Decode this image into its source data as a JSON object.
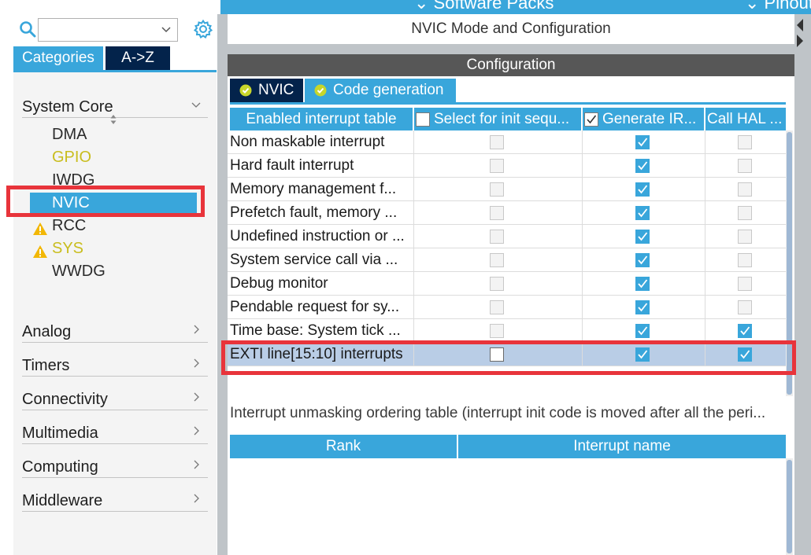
{
  "topbar": {
    "software_packs": "⌄ Software Packs",
    "pinout": "⌄ Pinout"
  },
  "search": {
    "value": "",
    "placeholder": ""
  },
  "tabs": {
    "categories": "Categories",
    "az": "A->Z"
  },
  "categories": [
    {
      "label": "System Core",
      "expanded": true
    },
    {
      "label": "Analog"
    },
    {
      "label": "Timers"
    },
    {
      "label": "Connectivity"
    },
    {
      "label": "Multimedia"
    },
    {
      "label": "Computing"
    },
    {
      "label": "Middleware"
    }
  ],
  "system_core_items": [
    {
      "label": "DMA",
      "warning": false,
      "configured": false,
      "selected": false
    },
    {
      "label": "GPIO",
      "warning": false,
      "configured": true,
      "selected": false
    },
    {
      "label": "IWDG",
      "warning": false,
      "configured": false,
      "selected": false
    },
    {
      "label": "NVIC",
      "warning": false,
      "configured": false,
      "selected": true
    },
    {
      "label": "RCC",
      "warning": true,
      "configured": false,
      "selected": false
    },
    {
      "label": "SYS",
      "warning": true,
      "configured": true,
      "selected": false
    },
    {
      "label": "WWDG",
      "warning": false,
      "configured": false,
      "selected": false
    }
  ],
  "mode_title": "NVIC Mode and Configuration",
  "config_title": "Configuration",
  "config_tabs": {
    "nvic": "NVIC",
    "code_generation": "Code generation"
  },
  "table": {
    "headers": [
      "Enabled interrupt table",
      "Select for init sequ...",
      "Generate IR...",
      "Call HAL ..."
    ],
    "rows": [
      {
        "name": "Non maskable interrupt",
        "select_init": "disabled-off",
        "generate_irq": "on",
        "call_hal": "disabled-off"
      },
      {
        "name": "Hard fault interrupt",
        "select_init": "disabled-off",
        "generate_irq": "on",
        "call_hal": "disabled-off"
      },
      {
        "name": "Memory management f...",
        "select_init": "disabled-off",
        "generate_irq": "on",
        "call_hal": "disabled-off"
      },
      {
        "name": "Prefetch fault, memory ...",
        "select_init": "disabled-off",
        "generate_irq": "on",
        "call_hal": "disabled-off"
      },
      {
        "name": "Undefined instruction or ...",
        "select_init": "disabled-off",
        "generate_irq": "on",
        "call_hal": "disabled-off"
      },
      {
        "name": "System service call via ...",
        "select_init": "disabled-off",
        "generate_irq": "on",
        "call_hal": "disabled-off"
      },
      {
        "name": "Debug monitor",
        "select_init": "disabled-off",
        "generate_irq": "on",
        "call_hal": "disabled-off"
      },
      {
        "name": "Pendable request for sy...",
        "select_init": "disabled-off",
        "generate_irq": "on",
        "call_hal": "disabled-off"
      },
      {
        "name": "Time base: System tick ...",
        "select_init": "disabled-off",
        "generate_irq": "on",
        "call_hal": "on"
      },
      {
        "name": "EXTI line[15:10] interrupts",
        "select_init": "off",
        "generate_irq": "on",
        "call_hal": "on",
        "highlighted": true
      }
    ]
  },
  "unmasking": {
    "title": "Interrupt unmasking ordering table (interrupt init code is moved after all the peri...",
    "headers": [
      "Rank",
      "Interrupt name"
    ]
  },
  "colors": {
    "accent": "#39a6db",
    "dark_navy": "#03234b",
    "header_gray": "#575757",
    "warning_yellow": "#c9bd1e",
    "row_highlight": "#b9cde6",
    "red_highlight": "#e8343b"
  },
  "icons": [
    "search-icon",
    "gear-icon",
    "chevron-down-icon",
    "chevron-right-icon",
    "sort-icon",
    "warning-icon",
    "check-circle-icon",
    "checkbox-icon"
  ]
}
